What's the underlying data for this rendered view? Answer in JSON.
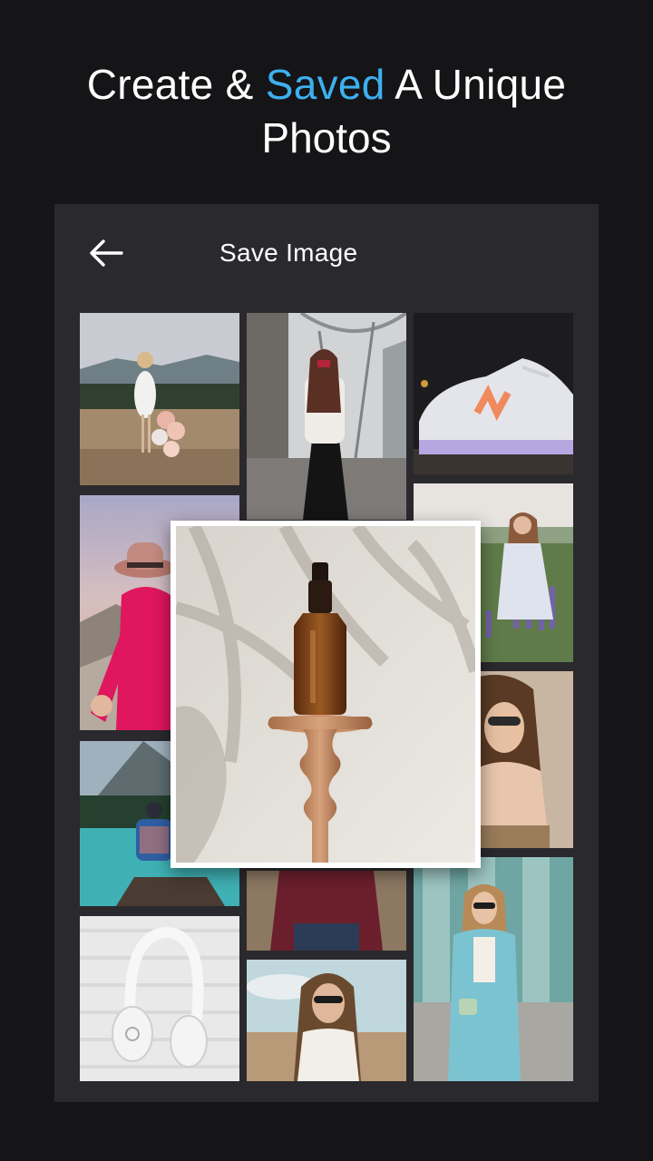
{
  "headline": {
    "line1_start": "Create & ",
    "line1_accent": "Saved",
    "line1_end": " A Unique",
    "line2": "Photos"
  },
  "colors": {
    "background": "#151417",
    "panel": "#2a292d",
    "accent": "#3db0ee",
    "text": "#ffffff"
  },
  "toolbar": {
    "back_icon": "arrow-left-icon",
    "title": "Save Image"
  },
  "gallery": {
    "photos": [
      "woman-with-balloons-photo",
      "eiffel-tower-woman-photo",
      "sneaker-photo",
      "woman-pink-hat-photo",
      "woman-in-field-photo",
      "lake-canoe-photo",
      "two-women-sunglasses-photo",
      "headphones-photo",
      "sweater-woman-photo",
      "woman-sunglasses-field-photo",
      "woman-blue-cardigan-photo"
    ],
    "featured_photo": "serum-bottle-photo"
  }
}
